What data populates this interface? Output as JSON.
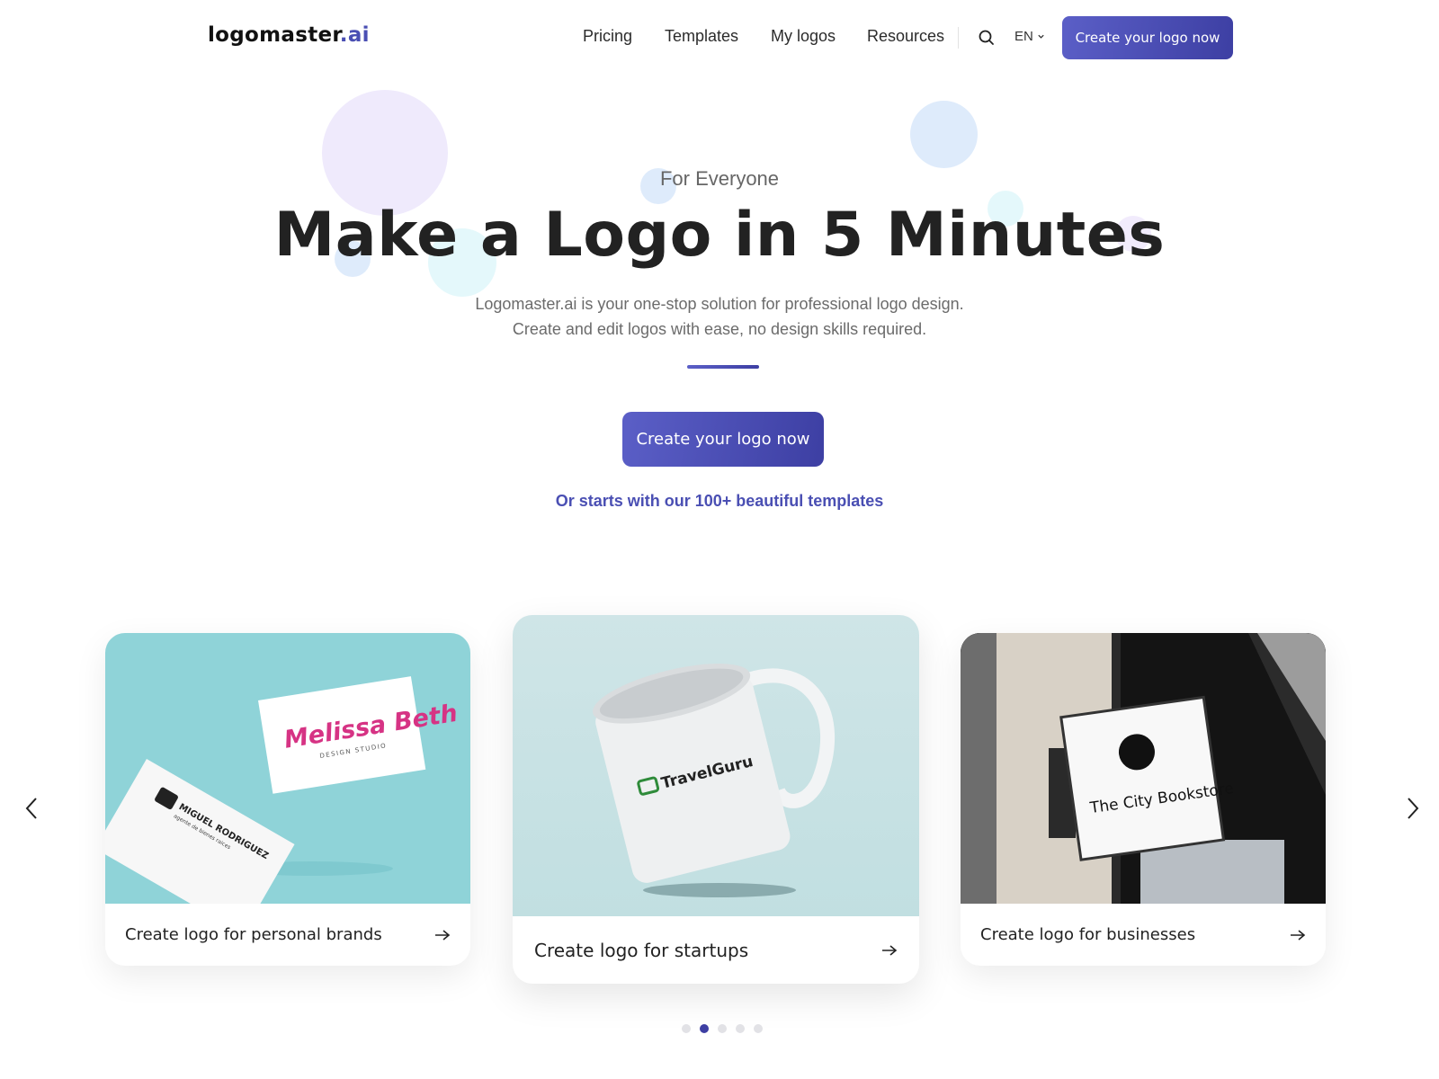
{
  "header": {
    "logo_main": "logomaster",
    "logo_suffix": ".ai",
    "nav": [
      {
        "label": "Pricing"
      },
      {
        "label": "Templates"
      },
      {
        "label": "My logos"
      },
      {
        "label": "Resources"
      }
    ],
    "search_icon": "search-icon",
    "language": "EN",
    "cta_label": "Create your logo now"
  },
  "hero": {
    "eyebrow": "For Everyone",
    "headline": "Make a Logo in 5 Minutes",
    "subline_1": "Logomaster.ai is your one-stop solution for professional logo design.",
    "subline_2": "Create and edit logos with ease, no design skills required.",
    "cta_label": "Create your logo now",
    "templates_link": "Or starts with our 100+ beautiful templates"
  },
  "carousel": {
    "cards": [
      {
        "label": "Create logo for personal brands",
        "image": {
          "card_a_name": "Melissa Beth",
          "card_a_subtitle": "DESIGN STUDIO",
          "card_b_name": "MIGUEL RODRIGUEZ",
          "card_b_subtitle": "agente de bienes raices"
        }
      },
      {
        "label": "Create logo for startups",
        "image": {
          "brand": "TravelGuru"
        }
      },
      {
        "label": "Create logo for businesses",
        "image": {
          "brand": "The City Bookstore"
        }
      }
    ],
    "page_count": 5,
    "active_page": 2
  },
  "colors": {
    "brand": "#4a4fb3",
    "brand_dark": "#3d3fa3",
    "bubble_lavender": "#efeafc",
    "bubble_blue": "#deebfb",
    "bubble_cyan": "#e4f8fb"
  }
}
